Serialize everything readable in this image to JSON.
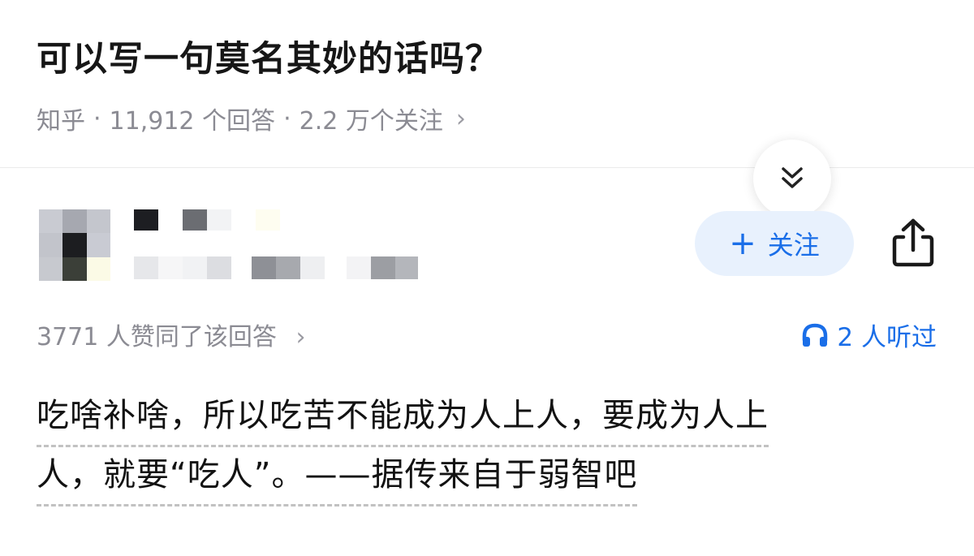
{
  "question": {
    "title": "可以写一句莫名其妙的话吗？",
    "source": "知乎",
    "answers_count": "11,912 个回答",
    "followers": "2.2 万个关注",
    "separator": "·",
    "chevron": "›"
  },
  "author": {
    "avatar_icon": "pixelated-avatar",
    "name_icon": "pixelated-name",
    "follow_label": "关注",
    "follow_icon": "plus-icon",
    "share_icon": "share-icon"
  },
  "collapse": {
    "icon": "double-chevron-down-icon"
  },
  "stats": {
    "upvotes": "3771 人赞同了该回答",
    "chevron": "›",
    "listened": "2 人听过",
    "listened_icon": "headphone-icon"
  },
  "answer": {
    "line1": "吃啥补啥，所以吃苦不能成为人上人，要成为人上",
    "line2": "人，就要“吃人”。——据传来自于弱智吧"
  },
  "colors": {
    "accent": "#1a6ee8",
    "follow_bg": "#e8f1fd",
    "muted_text": "#8b8b93",
    "title_text": "#161616"
  }
}
